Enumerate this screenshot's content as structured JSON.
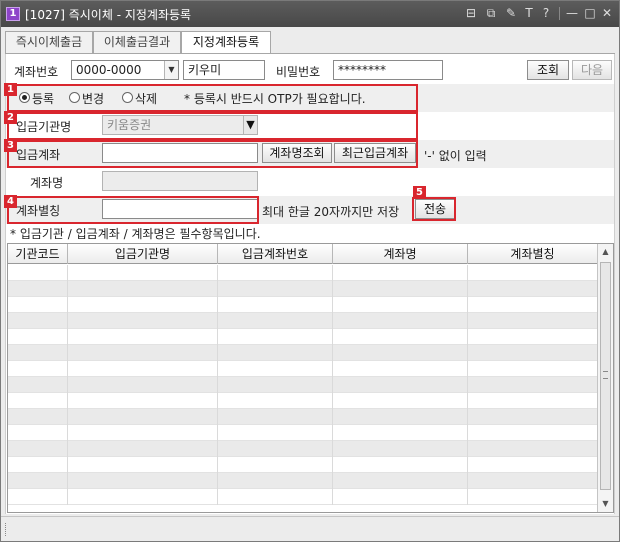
{
  "window": {
    "badge": "1",
    "title": "[1027] 즉시이체 - 지정계좌등록",
    "controls": [
      "⊟",
      "⧉",
      "✎",
      "T",
      "?",
      "—",
      "□",
      "✕"
    ]
  },
  "tabs": [
    "즉시이체출금",
    "이체출금결과",
    "지정계좌등록"
  ],
  "account": {
    "label": "계좌번호",
    "value": "0000-0000",
    "owner": "키우미",
    "password_label": "비밀번호",
    "password_value": "********",
    "query_button": "조회",
    "next_button": "다음"
  },
  "mode": {
    "options": [
      "등록",
      "변경",
      "삭제"
    ],
    "selected": 0,
    "notice": "* 등록시 반드시 OTP가 필요합니다."
  },
  "institution": {
    "label": "입금기관명",
    "value": "키움증권"
  },
  "deposit_account": {
    "label": "입금계좌",
    "value": "",
    "lookup_button": "계좌명조회",
    "recent_button": "최근입금계좌",
    "hint": "'-' 없이 입력"
  },
  "account_name": {
    "label": "계좌명",
    "value": ""
  },
  "alias": {
    "label": "계좌별칭",
    "value": "",
    "hint": "최대 한글 20자까지만 저장",
    "send_button": "전송"
  },
  "markers": [
    "1",
    "2",
    "3",
    "4",
    "5"
  ],
  "required_notice": "* 입금기관 / 입금계좌 / 계좌명은 필수항목입니다.",
  "grid": {
    "columns": [
      "기관코드",
      "입금기관명",
      "입금계좌번호",
      "계좌명",
      "계좌별칭"
    ],
    "rows": []
  },
  "colors": {
    "highlight": "#d9262e",
    "badge": "#8e44c9",
    "titlebar": "#4f4f4f"
  },
  "icons": [
    "minimize-window-icon",
    "restore-icon",
    "pin-icon",
    "font-size-icon",
    "help-icon",
    "minimize-icon",
    "maximize-icon",
    "close-icon"
  ]
}
